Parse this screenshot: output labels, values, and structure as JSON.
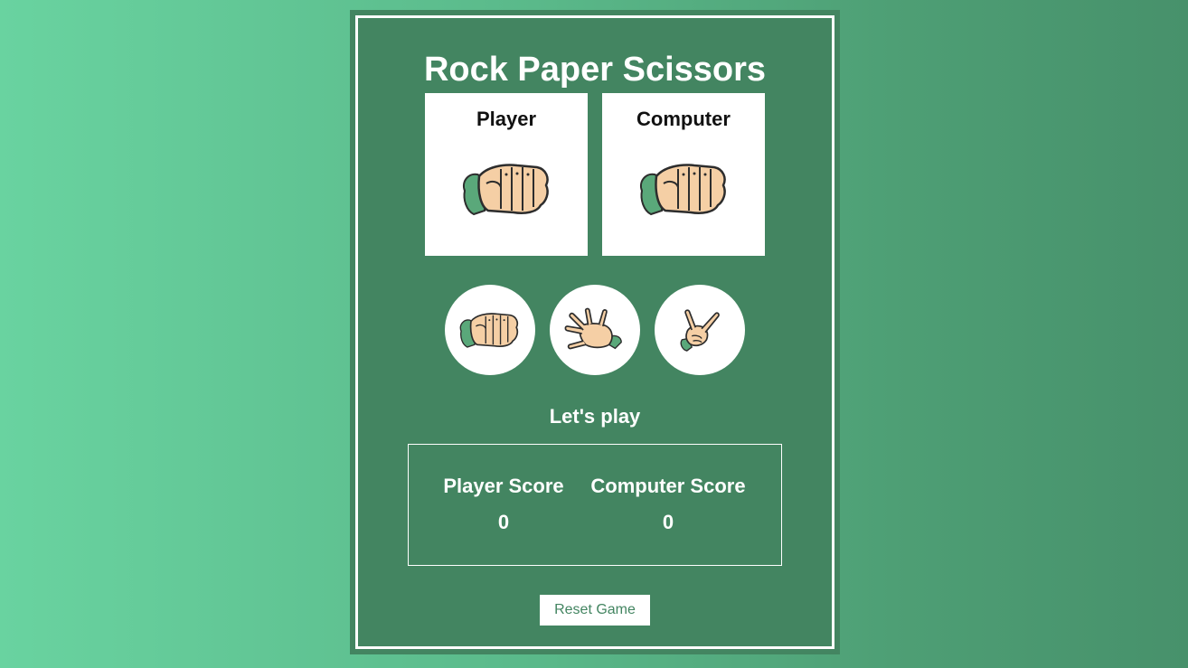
{
  "game": {
    "title": "Rock Paper Scissors",
    "player_label": "Player",
    "computer_label": "Computer",
    "player_choice_icon": "rock-hand-icon",
    "computer_choice_icon": "rock-hand-icon",
    "choices": [
      {
        "name": "rock",
        "icon": "rock-hand-icon"
      },
      {
        "name": "paper",
        "icon": "paper-hand-icon"
      },
      {
        "name": "scissors",
        "icon": "scissors-hand-icon"
      }
    ],
    "status": "Let's play",
    "score": {
      "player_heading": "Player Score",
      "computer_heading": "Computer Score",
      "player_value": "0",
      "computer_value": "0"
    },
    "reset_label": "Reset Game"
  },
  "colors": {
    "panel": "#438561",
    "hand_skin": "#f5cfa5",
    "sleeve": "#5aa87a"
  }
}
